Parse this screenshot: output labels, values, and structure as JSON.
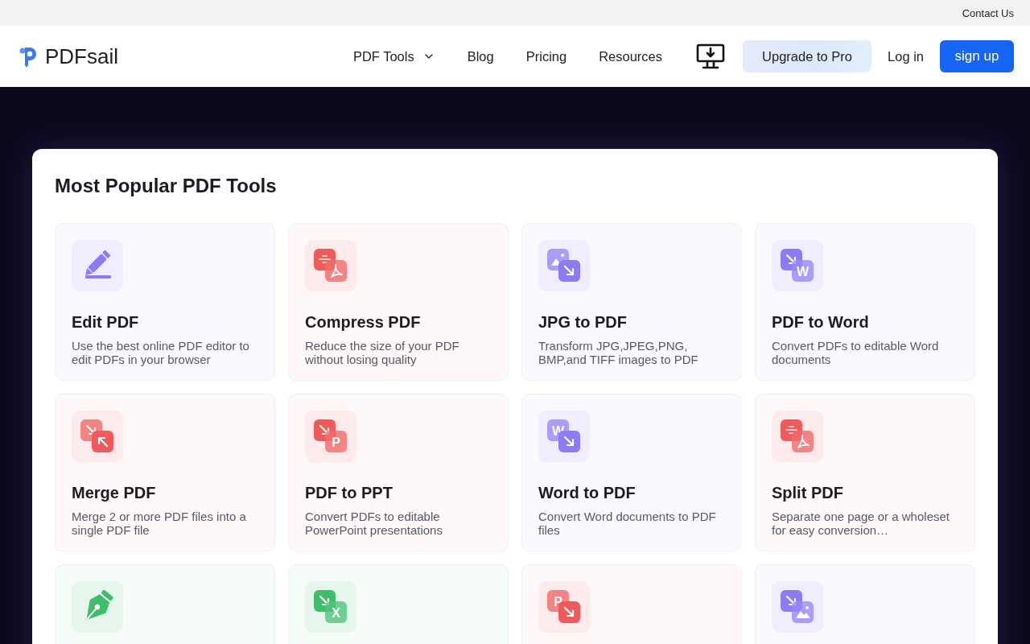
{
  "top_bar": {
    "contact_link": "Contact Us"
  },
  "header": {
    "logo_text": "PDFsail",
    "nav": [
      {
        "label": "PDF Tools",
        "kind": "dropdown"
      },
      {
        "label": "Blog",
        "kind": "link"
      },
      {
        "label": "Pricing",
        "kind": "link"
      },
      {
        "label": "Resources",
        "kind": "link"
      }
    ],
    "upgrade_button": "Upgrade to Pro",
    "login_link": "Log in",
    "signup_button": "sign up"
  },
  "tools": {
    "title": "Most Popular PDF Tools",
    "items": [
      {
        "title": "Edit PDF",
        "description": "Use the best online PDF editor to edit PDFs in your browser",
        "kind": "pencil",
        "color": "#8b7cf6"
      },
      {
        "title": "Compress PDF",
        "description": "Reduce the size of your PDF without losing quality",
        "kind": "compress",
        "color": "#f05a5a"
      },
      {
        "title": "JPG to PDF",
        "description": "Transform JPG,JPEG,PNG, BMP,and TIFF images to PDF",
        "kind": "image-to",
        "color": "#8b7cf6"
      },
      {
        "title": "PDF to Word",
        "description": "Convert PDFs to editable Word documents",
        "kind": "to-letter",
        "icon_letter": "W",
        "color": "#8b7cf6"
      },
      {
        "title": "Merge PDF",
        "description": "Merge 2 or more PDF files into a single PDF file",
        "kind": "merge",
        "color": "#f05a5a"
      },
      {
        "title": "PDF to PPT",
        "description": "Convert PDFs to editable PowerPoint presentations",
        "kind": "to-letter",
        "icon_letter": "P",
        "color": "#f05a5a"
      },
      {
        "title": "Word to PDF",
        "description": "Convert Word documents to PDF files",
        "kind": "letter-to",
        "icon_letter": "W",
        "color": "#8b7cf6"
      },
      {
        "title": "Split PDF",
        "description": "Separate one page or a wholeset for easy conversion…",
        "kind": "compress",
        "color": "#f05a5a"
      },
      {
        "kind": "pen",
        "color": "#3ebd6b"
      },
      {
        "kind": "to-letter",
        "icon_letter": "X",
        "color": "#3ebd6b"
      },
      {
        "kind": "letter-to",
        "icon_letter": "P",
        "color": "#f05a5a"
      },
      {
        "kind": "to-image",
        "color": "#8b7cf6"
      }
    ]
  }
}
